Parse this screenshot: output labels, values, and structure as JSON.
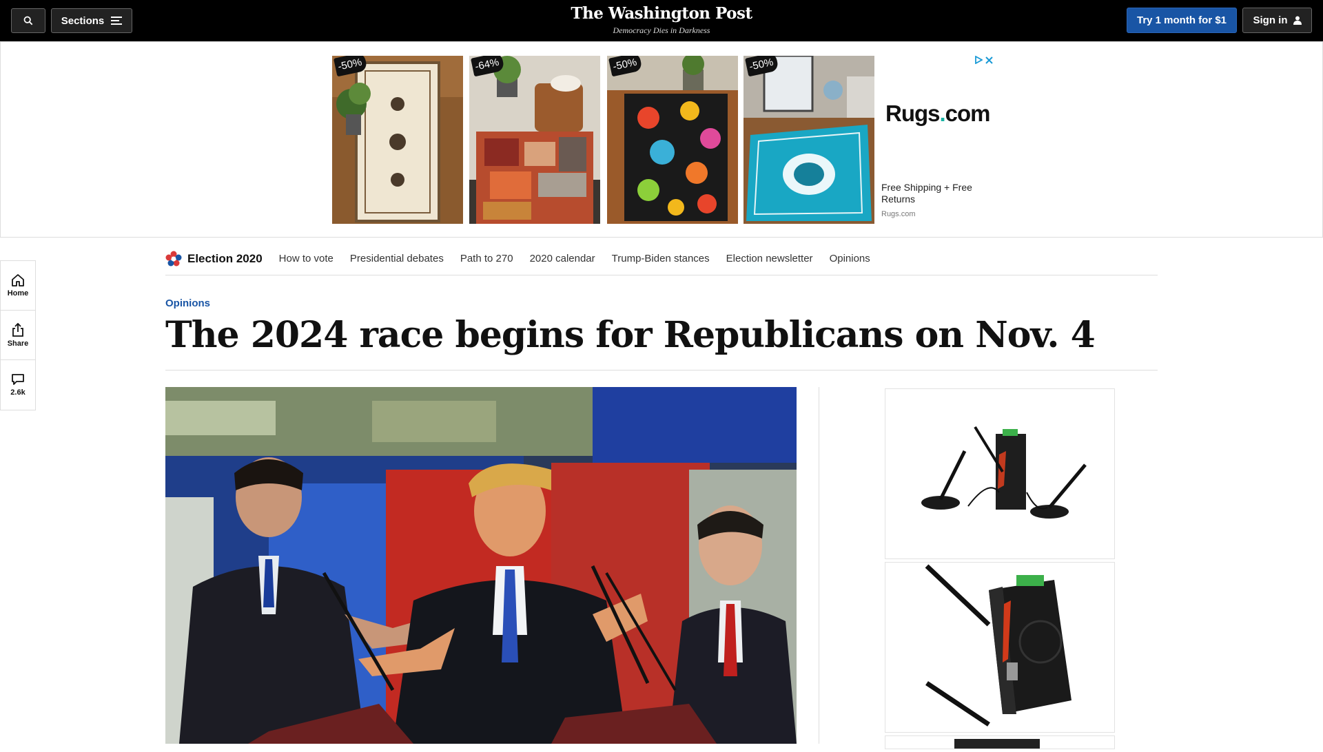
{
  "header": {
    "sections_label": "Sections",
    "logo": "The Washington Post",
    "tagline": "Democracy Dies in Darkness",
    "try_label": "Try 1 month for $1",
    "signin_label": "Sign in",
    "icons": [
      "search-icon",
      "menu-icon",
      "user-icon"
    ]
  },
  "banner_ad": {
    "badges": [
      "-50%",
      "-64%",
      "-50%",
      "-50%"
    ],
    "brand_name": "Rugs",
    "brand_dot": ".",
    "brand_tld": "com",
    "copy": "Free Shipping + Free Returns",
    "source": "Rugs.com",
    "icons": [
      "adchoices-icon",
      "close-icon"
    ]
  },
  "election_nav": {
    "title": "Election 2020",
    "links": [
      "How to vote",
      "Presidential debates",
      "Path to 270",
      "2020 calendar",
      "Trump-Biden stances",
      "Election newsletter",
      "Opinions"
    ]
  },
  "rail": {
    "home_label": "Home",
    "share_label": "Share",
    "comments_count": "2.6k"
  },
  "article": {
    "kicker": "Opinions",
    "headline": "The 2024 race begins for Republicans on Nov. 4"
  },
  "colors": {
    "brand_blue": "#1955a5",
    "topbar_bg": "#000000",
    "rugs_teal": "#19b2a4"
  }
}
